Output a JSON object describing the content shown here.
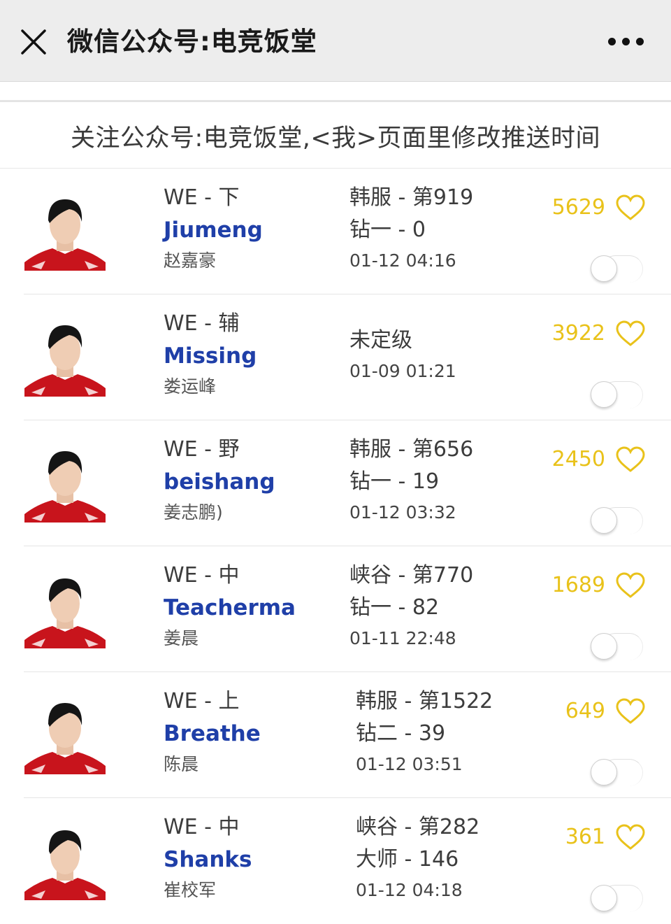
{
  "header": {
    "title": "微信公众号:电竞饭堂"
  },
  "notice": "关注公众号:电竞饭堂,<我>页面里修改推送时间",
  "colors": {
    "accent_likes": "#e9c21a",
    "ign_blue": "#1f3fa8",
    "jersey_red": "#c8141c"
  },
  "icons": {
    "close": "close-icon",
    "more": "more-icon",
    "like": "heart-icon"
  },
  "players": [
    {
      "team_role": "WE - 下",
      "ign": "Jiumeng",
      "realname": "赵嘉豪",
      "server_rank": "韩服 - 第919",
      "tier": "钻一 - 0",
      "time": "01-12 04:16",
      "likes": "5629"
    },
    {
      "team_role": "WE - 辅",
      "ign": "Missing",
      "realname": "娄运峰",
      "server_rank": "未定级",
      "time": "01-09 01:21",
      "likes": "3922"
    },
    {
      "team_role": "WE - 野",
      "ign": "beishang",
      "realname": "姜志鹏)",
      "server_rank": "韩服 - 第656",
      "tier": "钻一 - 19",
      "time": "01-12 03:32",
      "likes": "2450"
    },
    {
      "team_role": "WE - 中",
      "ign": "Teacherma",
      "realname": "姜晨",
      "server_rank": "峡谷 - 第770",
      "tier": "钻一 - 82",
      "time": "01-11 22:48",
      "likes": "1689"
    },
    {
      "team_role": "WE - 上",
      "ign": "Breathe",
      "realname": "陈晨",
      "server_rank": "韩服 - 第1522",
      "tier": "钻二 - 39",
      "time": "01-12 03:51",
      "likes": "649"
    },
    {
      "team_role": "WE - 中",
      "ign": "Shanks",
      "realname": "崔校军",
      "server_rank": "峡谷 - 第282",
      "tier": "大师 - 146",
      "time": "01-12 04:18",
      "likes": "361"
    }
  ]
}
